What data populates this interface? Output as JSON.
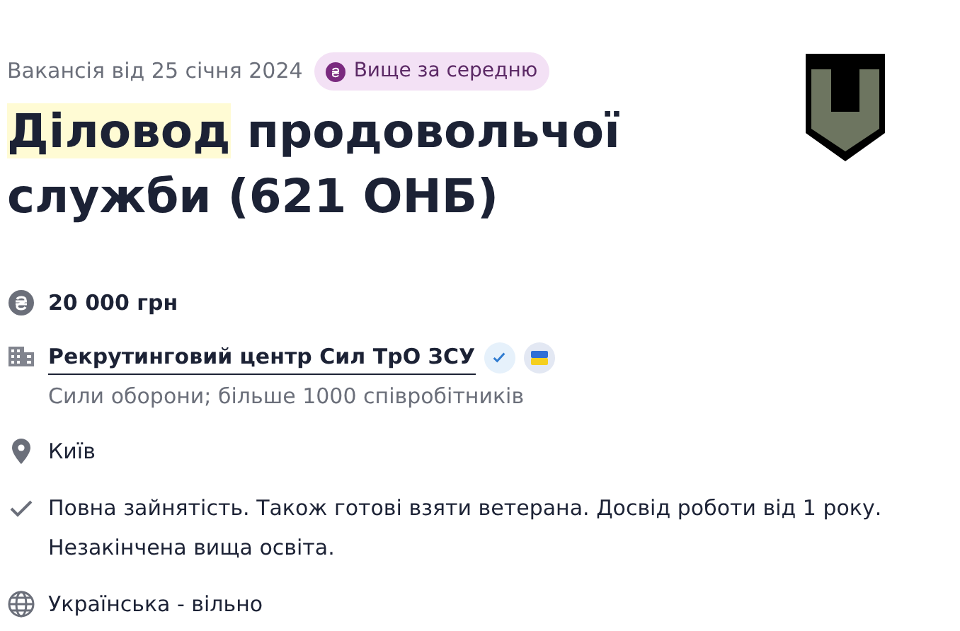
{
  "posted": "Вакансія від 25 січня 2024",
  "salary_badge": "Вище за середню",
  "title": {
    "highlight": "Діловод",
    "rest": "продовольчої служби (621 ОНБ)"
  },
  "details": [
    {
      "kind": "salary",
      "text": "20 000 грн"
    },
    {
      "kind": "company",
      "text": "Рекрутинговий центр Сил ТрО ЗСУ",
      "verified": true,
      "subtitle": "Сили оборони; більше 1000 співробітників"
    },
    {
      "kind": "location",
      "text": "Київ"
    },
    {
      "kind": "requirements",
      "text": "Повна зайнятість. Також готові взяти ветерана. Досвід роботи від 1 року. Незакінчена вища освіта."
    },
    {
      "kind": "language",
      "text": "Українська - вільно"
    }
  ]
}
